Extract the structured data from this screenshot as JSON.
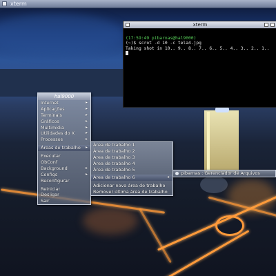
{
  "window": {
    "top_title": "xterm"
  },
  "terminal": {
    "title": "xterm",
    "prompt_line": "(17:59:49 pibarnas@hal9000)",
    "command_line": "(~)$ scrot -d 10 -c tela4.jpg",
    "output_line": "Taking shot in 10.. 9.. 8.. 7.. 6.. 5.. 4.. 3.. 2.. 1.."
  },
  "root_menu": {
    "title": "hal9000",
    "items": [
      "Internet",
      "Aplicações",
      "Terminais",
      "Gráficos",
      "Multimídia",
      "Utilidades do X",
      "Processos"
    ],
    "areas_label": "Áreas de trabalho",
    "items2": [
      "Executar",
      "ObConf",
      "Background",
      "Configs",
      "Reconfigurar"
    ],
    "items3": [
      "Reiniciar",
      "Desligar",
      "Sair"
    ]
  },
  "workspaces_menu": {
    "items": [
      "Área de trabalho 1",
      "Área de trabalho 2",
      "Área de trabalho 3",
      "Área de trabalho 4",
      "Área de trabalho 5",
      "Área de trabalho 6"
    ],
    "add_label": "Adicionar nova área de trabalho",
    "remove_label": "Remover última área de trabalho"
  },
  "window_list_menu": {
    "item": "pibarnas : Gerenciador de Arquivos"
  }
}
